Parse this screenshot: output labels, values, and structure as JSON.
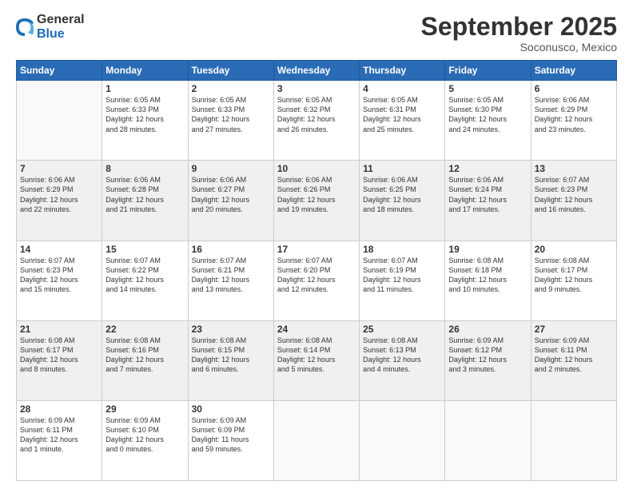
{
  "logo": {
    "line1": "General",
    "line2": "Blue"
  },
  "title": "September 2025",
  "location": "Soconusco, Mexico",
  "days_of_week": [
    "Sunday",
    "Monday",
    "Tuesday",
    "Wednesday",
    "Thursday",
    "Friday",
    "Saturday"
  ],
  "weeks": [
    [
      {
        "num": "",
        "info": ""
      },
      {
        "num": "1",
        "info": "Sunrise: 6:05 AM\nSunset: 6:33 PM\nDaylight: 12 hours\nand 28 minutes."
      },
      {
        "num": "2",
        "info": "Sunrise: 6:05 AM\nSunset: 6:33 PM\nDaylight: 12 hours\nand 27 minutes."
      },
      {
        "num": "3",
        "info": "Sunrise: 6:05 AM\nSunset: 6:32 PM\nDaylight: 12 hours\nand 26 minutes."
      },
      {
        "num": "4",
        "info": "Sunrise: 6:05 AM\nSunset: 6:31 PM\nDaylight: 12 hours\nand 25 minutes."
      },
      {
        "num": "5",
        "info": "Sunrise: 6:05 AM\nSunset: 6:30 PM\nDaylight: 12 hours\nand 24 minutes."
      },
      {
        "num": "6",
        "info": "Sunrise: 6:06 AM\nSunset: 6:29 PM\nDaylight: 12 hours\nand 23 minutes."
      }
    ],
    [
      {
        "num": "7",
        "info": "Sunrise: 6:06 AM\nSunset: 6:29 PM\nDaylight: 12 hours\nand 22 minutes."
      },
      {
        "num": "8",
        "info": "Sunrise: 6:06 AM\nSunset: 6:28 PM\nDaylight: 12 hours\nand 21 minutes."
      },
      {
        "num": "9",
        "info": "Sunrise: 6:06 AM\nSunset: 6:27 PM\nDaylight: 12 hours\nand 20 minutes."
      },
      {
        "num": "10",
        "info": "Sunrise: 6:06 AM\nSunset: 6:26 PM\nDaylight: 12 hours\nand 19 minutes."
      },
      {
        "num": "11",
        "info": "Sunrise: 6:06 AM\nSunset: 6:25 PM\nDaylight: 12 hours\nand 18 minutes."
      },
      {
        "num": "12",
        "info": "Sunrise: 6:06 AM\nSunset: 6:24 PM\nDaylight: 12 hours\nand 17 minutes."
      },
      {
        "num": "13",
        "info": "Sunrise: 6:07 AM\nSunset: 6:23 PM\nDaylight: 12 hours\nand 16 minutes."
      }
    ],
    [
      {
        "num": "14",
        "info": "Sunrise: 6:07 AM\nSunset: 6:23 PM\nDaylight: 12 hours\nand 15 minutes."
      },
      {
        "num": "15",
        "info": "Sunrise: 6:07 AM\nSunset: 6:22 PM\nDaylight: 12 hours\nand 14 minutes."
      },
      {
        "num": "16",
        "info": "Sunrise: 6:07 AM\nSunset: 6:21 PM\nDaylight: 12 hours\nand 13 minutes."
      },
      {
        "num": "17",
        "info": "Sunrise: 6:07 AM\nSunset: 6:20 PM\nDaylight: 12 hours\nand 12 minutes."
      },
      {
        "num": "18",
        "info": "Sunrise: 6:07 AM\nSunset: 6:19 PM\nDaylight: 12 hours\nand 11 minutes."
      },
      {
        "num": "19",
        "info": "Sunrise: 6:08 AM\nSunset: 6:18 PM\nDaylight: 12 hours\nand 10 minutes."
      },
      {
        "num": "20",
        "info": "Sunrise: 6:08 AM\nSunset: 6:17 PM\nDaylight: 12 hours\nand 9 minutes."
      }
    ],
    [
      {
        "num": "21",
        "info": "Sunrise: 6:08 AM\nSunset: 6:17 PM\nDaylight: 12 hours\nand 8 minutes."
      },
      {
        "num": "22",
        "info": "Sunrise: 6:08 AM\nSunset: 6:16 PM\nDaylight: 12 hours\nand 7 minutes."
      },
      {
        "num": "23",
        "info": "Sunrise: 6:08 AM\nSunset: 6:15 PM\nDaylight: 12 hours\nand 6 minutes."
      },
      {
        "num": "24",
        "info": "Sunrise: 6:08 AM\nSunset: 6:14 PM\nDaylight: 12 hours\nand 5 minutes."
      },
      {
        "num": "25",
        "info": "Sunrise: 6:08 AM\nSunset: 6:13 PM\nDaylight: 12 hours\nand 4 minutes."
      },
      {
        "num": "26",
        "info": "Sunrise: 6:09 AM\nSunset: 6:12 PM\nDaylight: 12 hours\nand 3 minutes."
      },
      {
        "num": "27",
        "info": "Sunrise: 6:09 AM\nSunset: 6:11 PM\nDaylight: 12 hours\nand 2 minutes."
      }
    ],
    [
      {
        "num": "28",
        "info": "Sunrise: 6:09 AM\nSunset: 6:11 PM\nDaylight: 12 hours\nand 1 minute."
      },
      {
        "num": "29",
        "info": "Sunrise: 6:09 AM\nSunset: 6:10 PM\nDaylight: 12 hours\nand 0 minutes."
      },
      {
        "num": "30",
        "info": "Sunrise: 6:09 AM\nSunset: 6:09 PM\nDaylight: 11 hours\nand 59 minutes."
      },
      {
        "num": "",
        "info": ""
      },
      {
        "num": "",
        "info": ""
      },
      {
        "num": "",
        "info": ""
      },
      {
        "num": "",
        "info": ""
      }
    ]
  ]
}
